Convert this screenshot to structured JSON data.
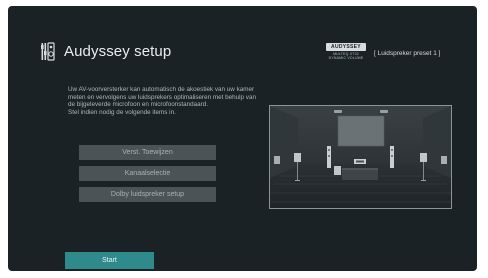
{
  "header": {
    "icon": "speaker-setup-icon",
    "title": "Audyssey setup"
  },
  "logo": {
    "top_text": "AUDYSSEY",
    "bottom_text": "MULTEQ XT32\nDYNAMIC VOLUME"
  },
  "preset_label": "[ Luidspreker preset 1 ]",
  "description": [
    "Uw AV-voorversterker kan automatisch de akoestiek van uw kamer meten en vervolgens uw luidsprekers optimaliseren met behulp van de bijgeleverde microfoon en microfoonstandaard.",
    "Stel indien nodig de volgende items in."
  ],
  "menu": {
    "items": [
      {
        "label": "Verst. Toewijzen"
      },
      {
        "label": "Kanaalselectie"
      },
      {
        "label": "Dolby luidspreker setup"
      }
    ]
  },
  "start_button": {
    "label": "Start"
  },
  "illustration": "home-theater-room-illustration",
  "colors": {
    "background": "#1b2226",
    "menu_button": "#4c5356",
    "start_button": "#2f8b8b"
  }
}
